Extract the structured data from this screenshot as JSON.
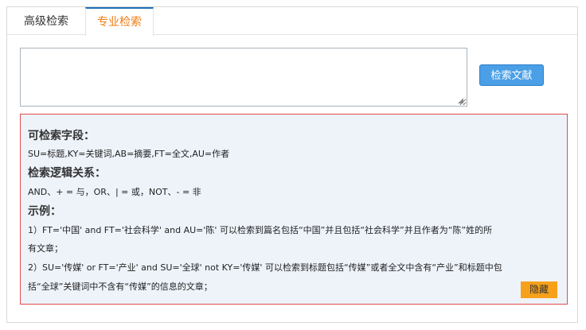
{
  "tabs": [
    {
      "label": "高级检索"
    },
    {
      "label": "专业检索"
    }
  ],
  "query": {
    "value": ""
  },
  "search_button": {
    "label": "检索文献"
  },
  "help": {
    "fields_title": "可检索字段：",
    "fields_text": "SU=标题,KY=关键词,AB=摘要,FT=全文,AU=作者",
    "logic_title": "检索逻辑关系：",
    "logic_text": "AND、+ = 与，OR、| = 或，NOT、- = 非",
    "examples_title": "示例：",
    "example1_line1": "1）FT='中国' and FT='社会科学' and AU='陈' 可以检索到篇名包括“中国”并且包括“社会科学”并且作者为“陈”姓的所",
    "example1_line2": "有文章；",
    "example2_line1": "2）SU='传媒' or FT='产业' and SU='全球' not KY='传媒' 可以检索到标题包括“传媒”或者全文中含有“产业”和标题中包",
    "example2_line2": "括“全球”关键词中不含有“传媒”的信息的文章；",
    "hide_label": "隐藏"
  },
  "colors": {
    "active_tab_text": "#f07c13",
    "active_tab_border": "#1d6fb8",
    "search_button": "#4a9fe6",
    "help_border": "#e24d4d",
    "help_background": "#eef3fa",
    "hide_button": "#f7a11a"
  }
}
